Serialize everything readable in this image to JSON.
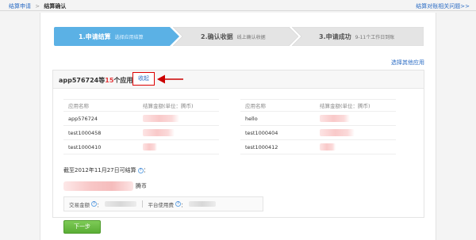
{
  "breadcrumb": {
    "parent": "结算申请",
    "separator": ">",
    "current": "结算确认"
  },
  "help_link": "结算对账相关问题>>",
  "steps": [
    {
      "title": "1.申请结算",
      "subtitle": "选择应用结算",
      "state": "active"
    },
    {
      "title": "2.确认收据",
      "subtitle": "线上确认收据",
      "state": "pending"
    },
    {
      "title": "3.申请成功",
      "subtitle": "9-11个工作日到账",
      "state": "pending"
    }
  ],
  "colors": {
    "step_active": "#5bb1e5",
    "step_pending": "#e4e4e4",
    "accent_red": "#e4393c",
    "link_blue": "#2b6cc4",
    "button_green": "#6bbd45"
  },
  "select_other_apps": "选择其他应用",
  "apps_box": {
    "title_prefix": "app576724等",
    "count": "15",
    "title_suffix": "个应用",
    "collapse_label": "收起"
  },
  "table": {
    "headers": {
      "name": "应用名称",
      "amount": "结算金额(单位：腾币)"
    },
    "left_rows": [
      {
        "name": "app576724",
        "amount": ""
      },
      {
        "name": "test1000458",
        "amount": ""
      },
      {
        "name": "test1000410",
        "amount": ""
      }
    ],
    "right_rows": [
      {
        "name": "hello",
        "amount": ""
      },
      {
        "name": "test1000404",
        "amount": ""
      },
      {
        "name": "test1000412",
        "amount": ""
      }
    ]
  },
  "settlement": {
    "cutoff_label": "截至2012年11月27日可结算",
    "colon": "：",
    "unit": "腾币",
    "help_icon": "?"
  },
  "fees": {
    "transaction_label": "交易金额",
    "platform_label": "平台使用费",
    "colon": "："
  },
  "next_button": "下一步"
}
